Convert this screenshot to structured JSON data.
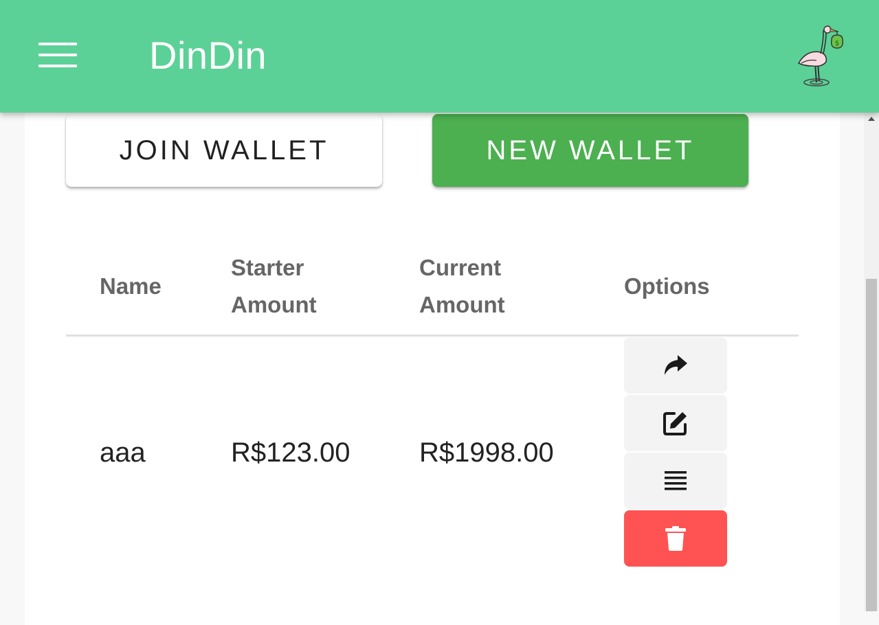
{
  "app": {
    "title": "DinDin"
  },
  "icons": {
    "menu": "hamburger-menu-icon",
    "logo": "stork-money-bag-logo",
    "share": "share-arrow-icon",
    "edit": "edit-pencil-icon",
    "list": "list-lines-icon",
    "delete": "trash-icon"
  },
  "colors": {
    "header": "#5cd197",
    "new_wallet": "#4caf50",
    "delete": "#ff5252"
  },
  "actions": {
    "join_wallet": "JOIN WALLET",
    "new_wallet": "NEW WALLET"
  },
  "table": {
    "headers": {
      "name": "Name",
      "starter_1": "Starter",
      "starter_2": "Amount",
      "current_1": "Current",
      "current_2": "Amount",
      "options": "Options"
    },
    "rows": [
      {
        "name": "aaa",
        "starter_amount": "R$123.00",
        "current_amount": "R$1998.00"
      }
    ]
  }
}
